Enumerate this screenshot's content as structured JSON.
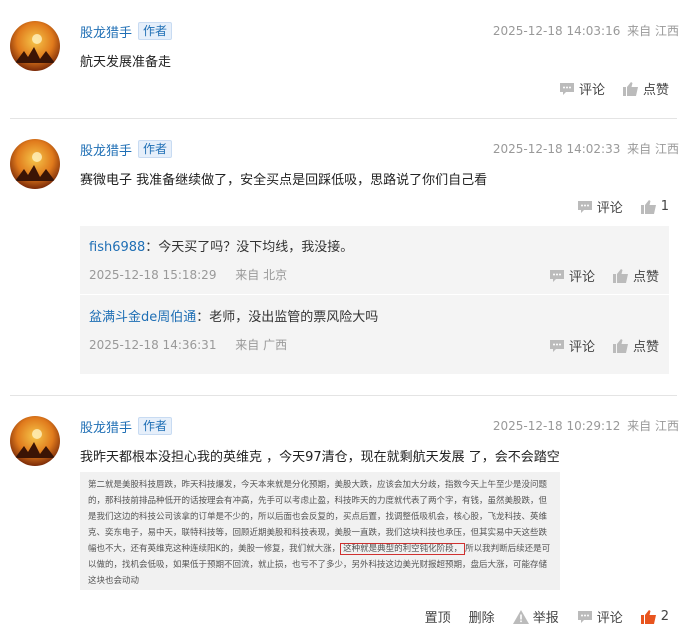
{
  "posts": [
    {
      "user": "股龙猎手",
      "badge": "作者",
      "time": "2025-12-18 14:03:16",
      "location": "来自 江西",
      "content": "航天发展准备走",
      "comment_label": "评论",
      "like_label": "点赞"
    },
    {
      "user": "股龙猎手",
      "badge": "作者",
      "time": "2025-12-18 14:02:33",
      "location": "来自 江西",
      "content": "赛微电子 我准备继续做了，安全买点是回踩低吸，思路说了你们自己看",
      "comment_label": "评论",
      "like_count": "1",
      "replies": [
        {
          "user": "fish6988",
          "text": "：今天买了吗？没下均线，我没接。",
          "time": "2025-12-18 15:18:29",
          "location": "来自 北京",
          "comment_label": "评论",
          "like_label": "点赞"
        },
        {
          "user": "盆满斗金de周伯通",
          "text": "：老师，没出监管的票风险大吗",
          "time": "2025-12-18 14:36:31",
          "location": "来自 广西",
          "comment_label": "评论",
          "like_label": "点赞"
        }
      ]
    },
    {
      "user": "股龙猎手",
      "badge": "作者",
      "time": "2025-12-18 10:29:12",
      "location": "来自 江西",
      "content": "我昨天都根本没担心我的英维克 ，今天97清仓，现在就剩航天发展 了，会不会踏空",
      "image_text_before": "第二就是美股科技唇跌，昨天科技爆发，今天本来就是分化预期，美股大跌，应该会加大分歧，指数今天上午至少是没问题的，那科技前排品种低开的话按理会有冲高，先手可以考虑止盈，科技昨天的力度就代表了两个字，有钱，虽然美股跌，但是我们这边的科技公司该拿的订单是不少的，所以后面也会反复的，买点后置，找调整低吸机会，核心股，飞龙科技、英维克、奕东电子，易中天，联特科技等，回顾近期美股和科技表现，美股一直跌，我们这块科技也承压，但其实易中天这些跌幅也不大，还有英维克这种连续阳K的，美股一修复，我们就大涨，",
      "image_text_highlight": "这种就是典型的利空钝化阶段，",
      "image_text_after": "所以我判断后续还是可以做的，找机会低吸，如果低于预期不回流，就止损，也亏不了多少，另外科技这边美光财报超预期，盘后大涨，可能存储这块也会动动",
      "pin_label": "置顶",
      "delete_label": "删除",
      "report_label": "举报",
      "comment_label": "评论",
      "like_count": "2"
    }
  ],
  "colors": {
    "link": "#1f6fb5",
    "meta": "#999999",
    "liked": "#e8541e",
    "highlight_border": "#d0302f"
  },
  "icons": [
    "comment-icon",
    "thumbs-up-icon",
    "warning-icon",
    "avatar-image"
  ]
}
